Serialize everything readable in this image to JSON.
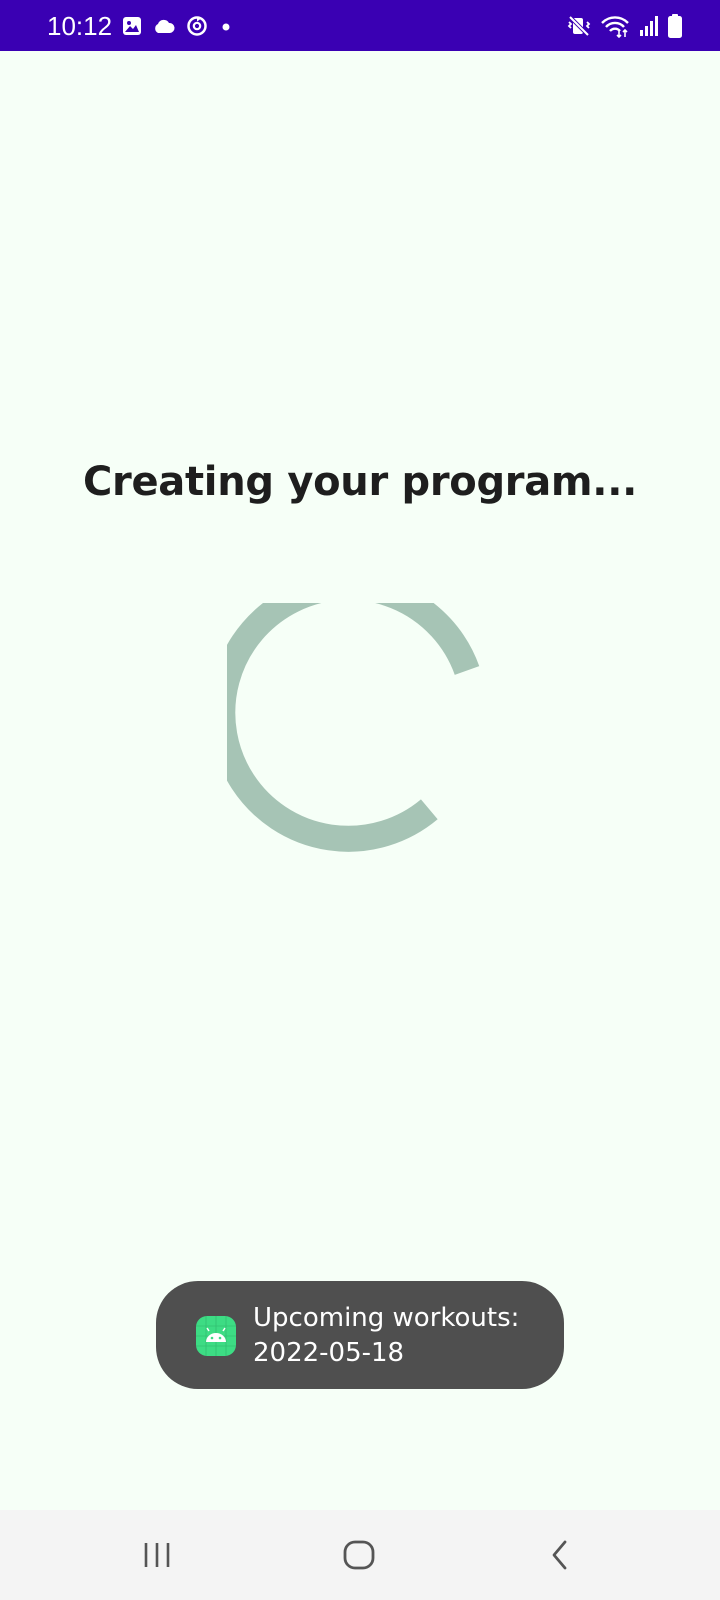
{
  "status_bar": {
    "time": "10:12",
    "background_color": "#3a00b3",
    "left_icons": [
      "gallery-icon",
      "cloud-icon",
      "sync-icon",
      "dot-icon"
    ],
    "right_icons": [
      "vibrate-mute-icon",
      "wifi-icon",
      "signal-icon",
      "battery-icon"
    ]
  },
  "main": {
    "title": "Creating your program...",
    "background_color": "#f6fff7",
    "spinner": {
      "icon": "loading-spinner-icon",
      "color": "#a6c4b5"
    }
  },
  "toast": {
    "app_icon": "android-app-icon",
    "line1": "Upcoming workouts:",
    "line2": "2022-05-18",
    "background_color": "#4f4f4f"
  },
  "nav_bar": {
    "buttons": [
      {
        "name": "recents",
        "icon": "recents-icon"
      },
      {
        "name": "home",
        "icon": "home-icon"
      },
      {
        "name": "back",
        "icon": "back-icon"
      }
    ]
  }
}
